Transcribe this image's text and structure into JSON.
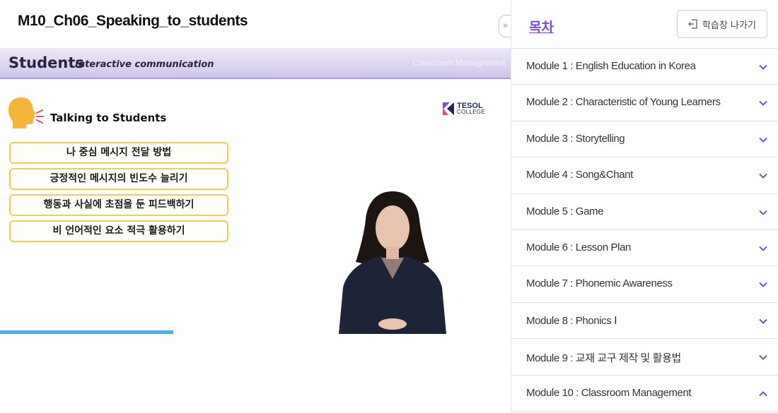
{
  "course": {
    "title": "M10_Ch06_Speaking_to_students"
  },
  "collapse_glyph": "»",
  "slide": {
    "header_main": "Students",
    "header_sub": "Interactive communication",
    "header_right": "Classroom Management",
    "talk_title": "Talking to Students",
    "logo_line1": "TESOL",
    "logo_line2": "COLLEGE",
    "tips": [
      "나 중심 메시지 전달 방법",
      "긍정적인 메시지의 빈도수 늘리기",
      "행동과 사실에 초점을 둔 피드백하기",
      "비 언어적인 요소 적극 활용하기"
    ]
  },
  "video": {
    "progress": 0.34,
    "progress_color": "#5aa9dc"
  },
  "toc": {
    "title": "목차",
    "exit_label": "학습창 나가기",
    "accent_color": "#7a4fcf",
    "modules": [
      {
        "label": "Module 1 : English Education in Korea",
        "expanded": false
      },
      {
        "label": "Module 2 : Characteristic of Young Learners",
        "expanded": false
      },
      {
        "label": "Module 3 : Storytelling",
        "expanded": false
      },
      {
        "label": "Module 4 : Song&Chant",
        "expanded": false
      },
      {
        "label": "Module 5 : Game",
        "expanded": false
      },
      {
        "label": "Module 6 : Lesson Plan",
        "expanded": false
      },
      {
        "label": "Module 7 : Phonemic Awareness",
        "expanded": false
      },
      {
        "label": "Module 8 : Phonics Ⅰ",
        "expanded": false
      },
      {
        "label": "Module 9 : 교재 교구 제작 및 활용법",
        "expanded": false
      },
      {
        "label": "Module 10 : Classroom Management",
        "expanded": true
      }
    ]
  }
}
